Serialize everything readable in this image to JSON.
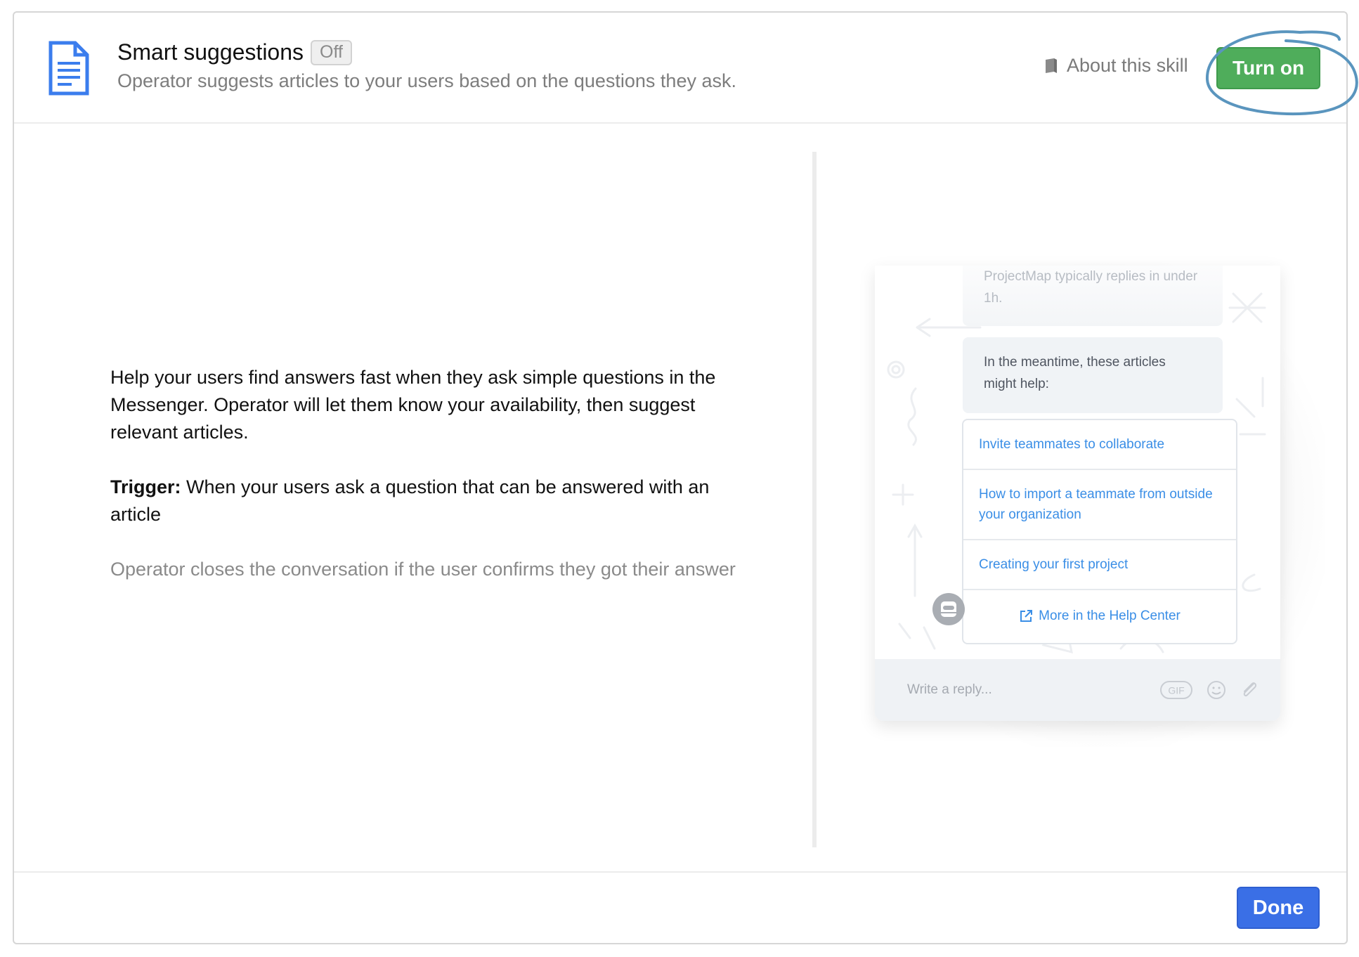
{
  "header": {
    "title": "Smart suggestions",
    "status_badge": "Off",
    "subtitle": "Operator suggests articles to your users based on the questions they ask.",
    "about_link": "About this skill",
    "turn_on_label": "Turn on",
    "icon": "document-icon",
    "accent_color": "#3b7ded",
    "turn_on_color": "#4fad5b"
  },
  "description": {
    "intro": "Help your users find answers fast when they ask simple questions in the Messenger. Operator will let them know your availability, then suggest relevant articles.",
    "trigger_label": "Trigger:",
    "trigger_text": " When your users ask a question that can be answered with an article",
    "note": "Operator closes the conversation if the user confirms they got their answer"
  },
  "preview": {
    "faded_message": "ProjectMap typically replies in under 1h.",
    "message": "In the meantime, these articles might help:",
    "articles": [
      "Invite teammates to collaborate",
      "How to import a teammate from outside your organization",
      "Creating your first project"
    ],
    "more_link": "More in the Help Center",
    "composer_placeholder": "Write a reply...",
    "gif_label": "GIF",
    "link_color": "#3a8ee6"
  },
  "footer": {
    "done_label": "Done",
    "done_color": "#3a6fe6"
  }
}
